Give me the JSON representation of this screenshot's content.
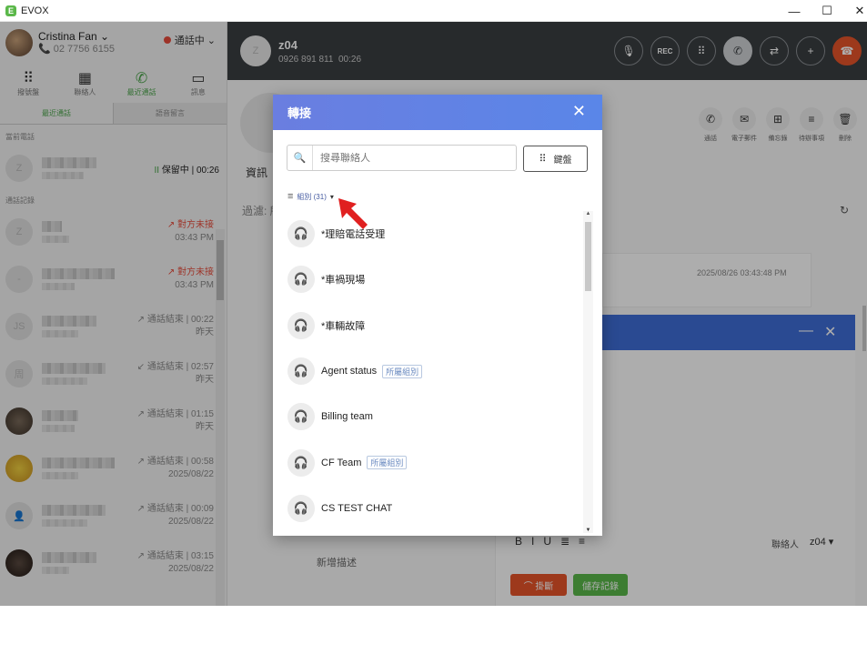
{
  "window": {
    "app_title": "EVOX",
    "minimize": "—",
    "maximize": "☐",
    "close": "✕"
  },
  "agent": {
    "name": "Cristina Fan ⌄",
    "number": "📞 02 7756 6155",
    "status": "通話中 ⌄"
  },
  "nav": [
    {
      "label": "撥號盤",
      "icon": "⠿"
    },
    {
      "label": "聯絡人",
      "icon": "▦"
    },
    {
      "label": "最近通話",
      "icon": "✆"
    },
    {
      "label": "訊息",
      "icon": "▭"
    }
  ],
  "subtabs": {
    "recent": "最近通話",
    "voicemail": "語音留言"
  },
  "sections": {
    "current": "當前電話",
    "history": "通話記錄"
  },
  "current_call": {
    "avatar": "Z",
    "state": "保留中 | 00:26",
    "hold_icon": "II"
  },
  "history": [
    {
      "avatar": "Z",
      "status": "↗ 對方未接",
      "time": "03:43 PM",
      "missed": true
    },
    {
      "avatar": "-",
      "status": "↗ 對方未接",
      "time": "03:43 PM",
      "missed": true
    },
    {
      "avatar": "JS",
      "status": "↗ 通話結束 | 00:22",
      "time": "昨天",
      "missed": false
    },
    {
      "avatar": "周",
      "status": "↙ 通話結束 | 02:57",
      "time": "昨天",
      "missed": false
    },
    {
      "avatar": "",
      "status": "↗ 通話結束 | 01:15",
      "time": "昨天",
      "missed": false
    },
    {
      "avatar": "",
      "status": "↗ 通話結束 | 00:58",
      "time": "2025/08/22",
      "missed": false
    },
    {
      "avatar": "👤",
      "status": "↗ 通話結束 | 00:09",
      "time": "2025/08/22",
      "missed": false
    },
    {
      "avatar": "",
      "status": "↗ 通話結束 | 03:15",
      "time": "2025/08/22",
      "missed": false
    }
  ],
  "call": {
    "avatar": "Z",
    "name": "z04",
    "number": "0926 891 811",
    "duration": "00:26"
  },
  "call_buttons": [
    "🎙",
    "REC",
    "⠿",
    "✆",
    "⇄",
    "+",
    "☎"
  ],
  "detail": {
    "info_tab": "資訊",
    "filter": "過濾: 所",
    "refresh": "↻",
    "note_date": "2025/08/26 03:43:48 PM",
    "actions": [
      {
        "label": "通話",
        "icon": "✆"
      },
      {
        "label": "電子郵件",
        "icon": "✉"
      },
      {
        "label": "備忘錄",
        "icon": "⊞"
      },
      {
        "label": "待辦事項",
        "icon": "≡"
      },
      {
        "label": "刪除",
        "icon": "🗑"
      }
    ],
    "panel_minimize": "—",
    "panel_close": "✕",
    "format_tools": "BIU≣≡",
    "contact_label": "聯絡人",
    "contact_value": "z04 ▾",
    "new_desc": "新增描述",
    "hangup": "⌒ 掛斷",
    "save": "儲存記錄"
  },
  "modal": {
    "title": "轉接",
    "close": "✕",
    "search_placeholder": "搜尋聯絡人",
    "search_icon": "🔍",
    "keypad_icon": "⠿",
    "keypad_label": "鍵盤",
    "groups_label": "組別 (31)",
    "groups_icon": "≡",
    "groups_caret": "▾",
    "items": [
      {
        "label": "*理賠電話受理",
        "tag": ""
      },
      {
        "label": "*車禍現場",
        "tag": ""
      },
      {
        "label": "*車輛故障",
        "tag": ""
      },
      {
        "label": "Agent status",
        "tag": "所屬組別"
      },
      {
        "label": "Billing team",
        "tag": ""
      },
      {
        "label": "CF Team",
        "tag": "所屬組別"
      },
      {
        "label": "CS TEST CHAT",
        "tag": ""
      }
    ],
    "item_icon": "🎧",
    "scroll_up": "▲",
    "scroll_down": "▼"
  },
  "colors": {
    "accent": "#4aa44a",
    "modal_header": "#5a86e8",
    "hangup": "#e8552a",
    "missed": "#e74c3c"
  }
}
